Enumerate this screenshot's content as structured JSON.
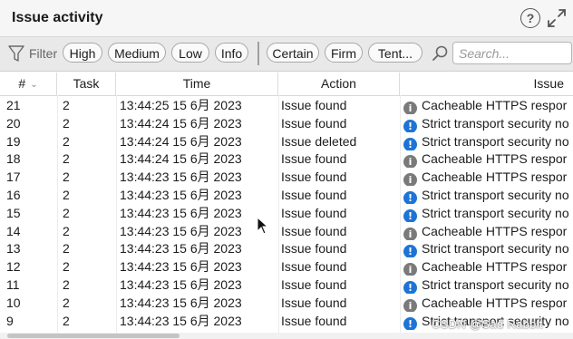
{
  "panel": {
    "title": "Issue activity"
  },
  "toolbar": {
    "help_glyph": "?",
    "filter_label": "Filter",
    "severity_chips": [
      "High",
      "Medium",
      "Low",
      "Info"
    ],
    "confidence_chips": [
      "Certain",
      "Firm",
      "Tent..."
    ],
    "search_placeholder": "Search..."
  },
  "table": {
    "columns": [
      "#",
      "Task",
      "Time",
      "Action",
      "Issue"
    ],
    "rows": [
      {
        "id": "21",
        "task": "2",
        "time": "13:44:25 15 6月 2023",
        "action": "Issue found",
        "severity": "info",
        "issue": "Cacheable HTTPS respor"
      },
      {
        "id": "20",
        "task": "2",
        "time": "13:44:24 15 6月 2023",
        "action": "Issue found",
        "severity": "low",
        "issue": "Strict transport security no"
      },
      {
        "id": "19",
        "task": "2",
        "time": "13:44:24 15 6月 2023",
        "action": "Issue deleted",
        "severity": "low",
        "issue": "Strict transport security no"
      },
      {
        "id": "18",
        "task": "2",
        "time": "13:44:24 15 6月 2023",
        "action": "Issue found",
        "severity": "info",
        "issue": "Cacheable HTTPS respor"
      },
      {
        "id": "17",
        "task": "2",
        "time": "13:44:23 15 6月 2023",
        "action": "Issue found",
        "severity": "info",
        "issue": "Cacheable HTTPS respor"
      },
      {
        "id": "16",
        "task": "2",
        "time": "13:44:23 15 6月 2023",
        "action": "Issue found",
        "severity": "low",
        "issue": "Strict transport security no"
      },
      {
        "id": "15",
        "task": "2",
        "time": "13:44:23 15 6月 2023",
        "action": "Issue found",
        "severity": "low",
        "issue": "Strict transport security no"
      },
      {
        "id": "14",
        "task": "2",
        "time": "13:44:23 15 6月 2023",
        "action": "Issue found",
        "severity": "info",
        "issue": "Cacheable HTTPS respor"
      },
      {
        "id": "13",
        "task": "2",
        "time": "13:44:23 15 6月 2023",
        "action": "Issue found",
        "severity": "low",
        "issue": "Strict transport security no"
      },
      {
        "id": "12",
        "task": "2",
        "time": "13:44:23 15 6月 2023",
        "action": "Issue found",
        "severity": "info",
        "issue": "Cacheable HTTPS respor"
      },
      {
        "id": "11",
        "task": "2",
        "time": "13:44:23 15 6月 2023",
        "action": "Issue found",
        "severity": "low",
        "issue": "Strict transport security no"
      },
      {
        "id": "10",
        "task": "2",
        "time": "13:44:23 15 6月 2023",
        "action": "Issue found",
        "severity": "info",
        "issue": "Cacheable HTTPS respor"
      },
      {
        "id": "9",
        "task": "2",
        "time": "13:44:23 15 6月 2023",
        "action": "Issue found",
        "severity": "low",
        "issue": "Strict transport security no"
      }
    ]
  },
  "severity_style": {
    "info": {
      "color": "#7a7a7a",
      "glyph": "i",
      "icon_name": "info-severity-icon"
    },
    "low": {
      "color": "#1e74d6",
      "glyph": "!",
      "icon_name": "low-severity-icon"
    }
  },
  "watermark": "CSDN @Sad Rabbit"
}
